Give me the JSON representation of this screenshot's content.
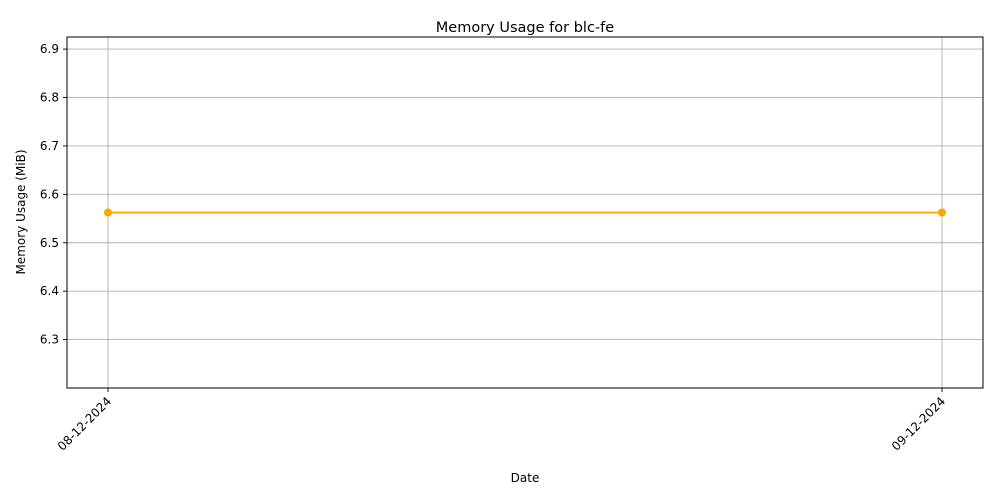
{
  "chart_data": {
    "type": "line",
    "title": "Memory Usage for blc-fe",
    "xlabel": "Date",
    "ylabel": "Memory Usage (MiB)",
    "x": [
      "08-12-2024",
      "09-12-2024"
    ],
    "series": [
      {
        "values": [
          6.5625,
          6.5625
        ],
        "color": "#ffa500",
        "marker": "circle"
      }
    ],
    "yticks": [
      "6.3",
      "6.4",
      "6.5",
      "6.6",
      "6.7",
      "6.8",
      "6.9"
    ],
    "ytick_values": [
      6.3,
      6.4,
      6.5,
      6.6,
      6.7,
      6.8,
      6.9
    ],
    "ylim": [
      6.2,
      6.925
    ],
    "grid": true,
    "xtick_rotation": "45°"
  }
}
